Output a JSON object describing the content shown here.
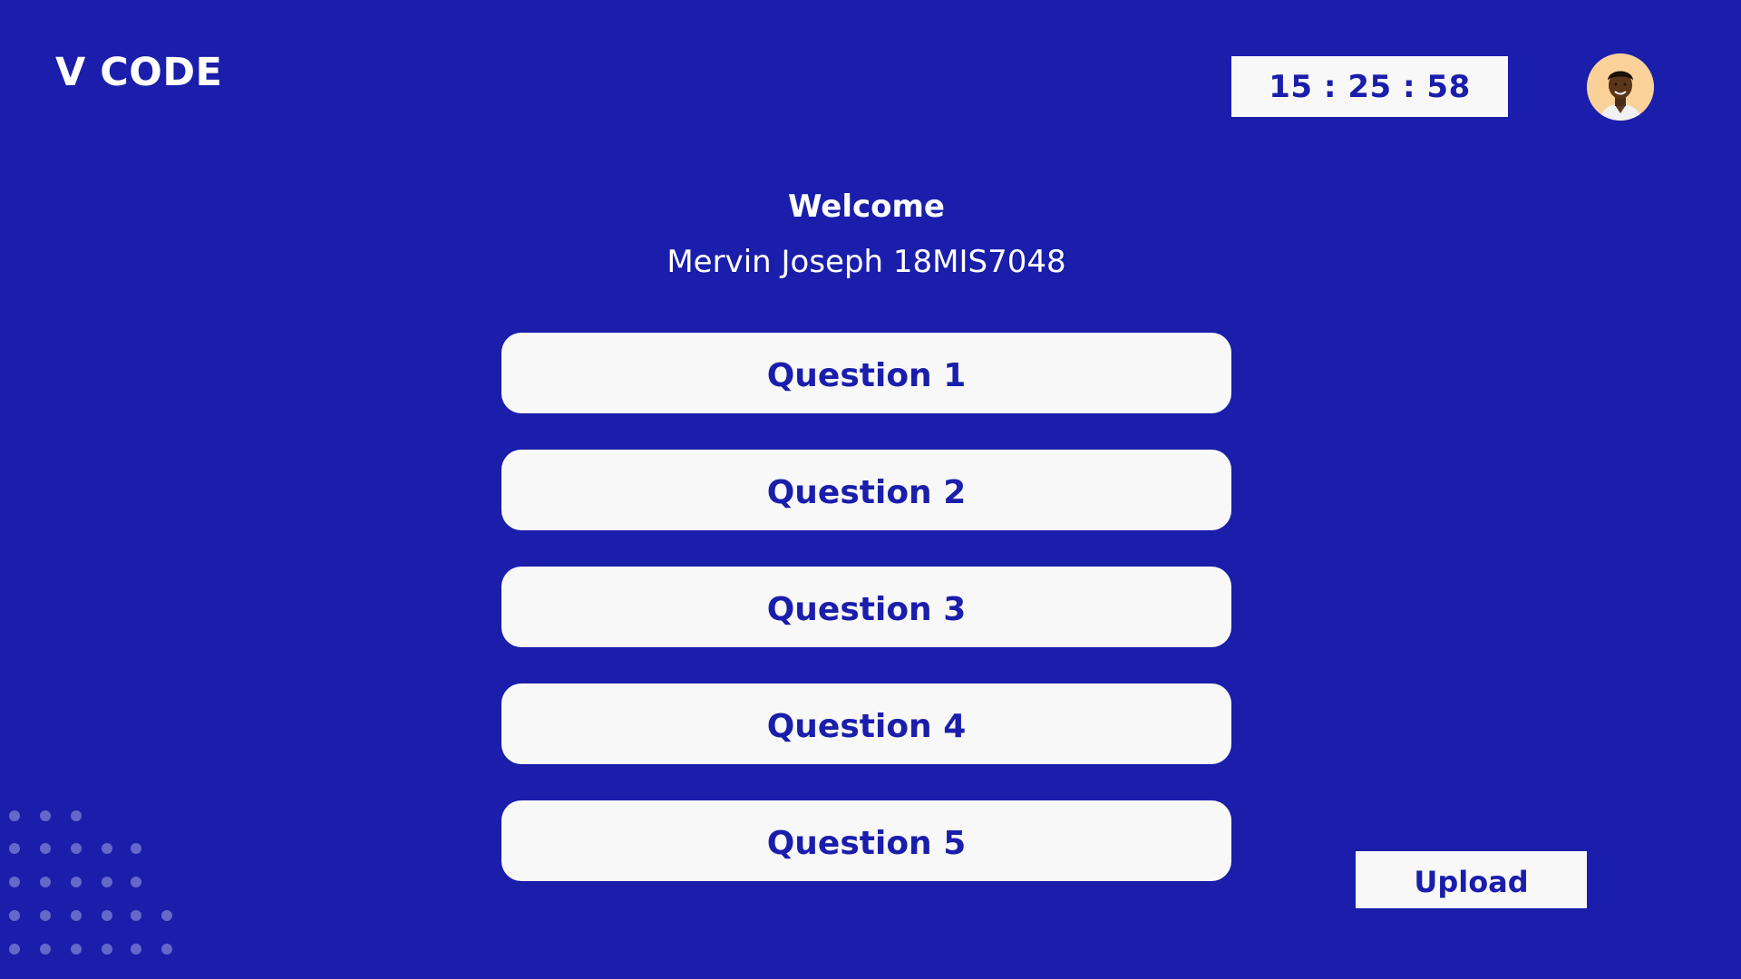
{
  "app": {
    "logo": "V CODE"
  },
  "header": {
    "timer": "15 : 25 : 58",
    "avatar_icon": "user-avatar-icon"
  },
  "welcome": {
    "title": "Welcome",
    "user": "Mervin Joseph 18MIS7048"
  },
  "questions": [
    {
      "label": "Question 1"
    },
    {
      "label": "Question 2"
    },
    {
      "label": "Question 3"
    },
    {
      "label": "Question 4"
    },
    {
      "label": "Question 5"
    }
  ],
  "actions": {
    "upload_label": "Upload"
  },
  "colors": {
    "background": "#1a1eab",
    "button_bg": "#f8f8f8",
    "accent_text": "#1a1eab",
    "dots": "#6468c8"
  }
}
